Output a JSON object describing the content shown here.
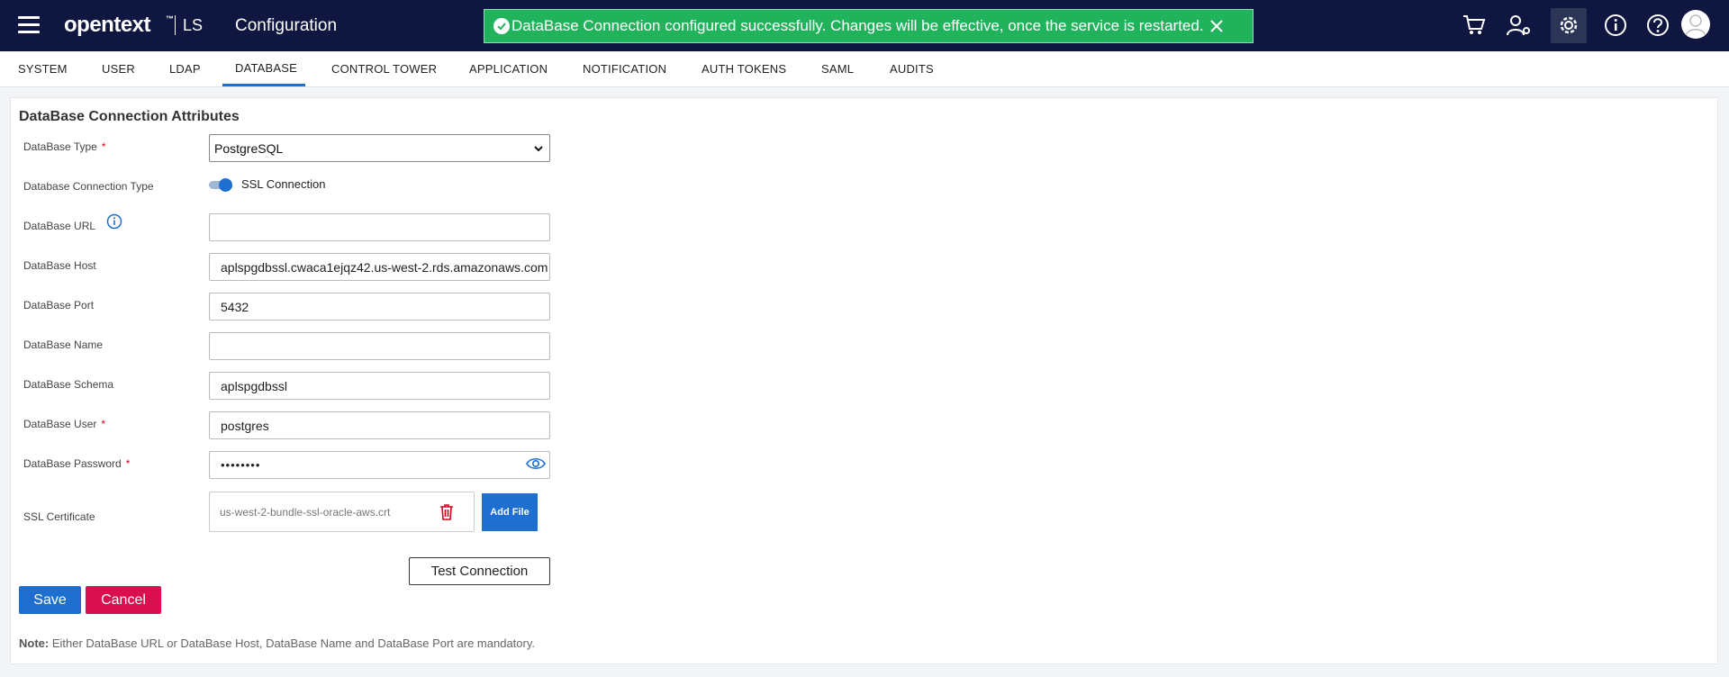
{
  "header": {
    "logo": "opentext",
    "logo_tm": "™",
    "product": "LS",
    "title": "Configuration",
    "toast": "DataBase Connection configured successfully. Changes will be effective, once the service is restarted."
  },
  "tabs": [
    {
      "label": "SYSTEM"
    },
    {
      "label": "USER"
    },
    {
      "label": "LDAP"
    },
    {
      "label": "DATABASE",
      "active": true
    },
    {
      "label": "CONTROL TOWER"
    },
    {
      "label": "APPLICATION"
    },
    {
      "label": "NOTIFICATION"
    },
    {
      "label": "AUTH TOKENS"
    },
    {
      "label": "SAML"
    },
    {
      "label": "AUDITS"
    }
  ],
  "form": {
    "section_title": "DataBase Connection Attributes",
    "required_mark": "*",
    "db_type": {
      "label": "DataBase Type",
      "value": "PostgreSQL"
    },
    "connection_type": {
      "label": "Database Connection Type",
      "toggle_label": "SSL Connection",
      "enabled": true
    },
    "db_url": {
      "label": "DataBase URL",
      "value": ""
    },
    "db_host": {
      "label": "DataBase Host",
      "value": "aplspgdbssl.cwaca1ejqz42.us-west-2.rds.amazonaws.com"
    },
    "db_port": {
      "label": "DataBase Port",
      "value": "5432"
    },
    "db_name": {
      "label": "DataBase Name",
      "value": ""
    },
    "db_schema": {
      "label": "DataBase Schema",
      "value": "aplspgdbssl"
    },
    "db_user": {
      "label": "DataBase User",
      "value": "postgres"
    },
    "db_password": {
      "label": "DataBase Password",
      "value": "••••••••"
    },
    "ssl_cert": {
      "label": "SSL Certificate",
      "file_name": "us-west-2-bundle-ssl-oracle-aws.crt",
      "add_label": "Add File"
    },
    "test_label": "Test Connection",
    "save_label": "Save",
    "cancel_label": "Cancel",
    "note_prefix": "Note:",
    "note_text": " Either DataBase URL or DataBase Host, DataBase Name and DataBase Port are mandatory."
  },
  "colors": {
    "header_bg": "#0f1740",
    "toast_bg": "#21b35c",
    "primary": "#1f6fd1",
    "danger": "#d90f4f"
  }
}
